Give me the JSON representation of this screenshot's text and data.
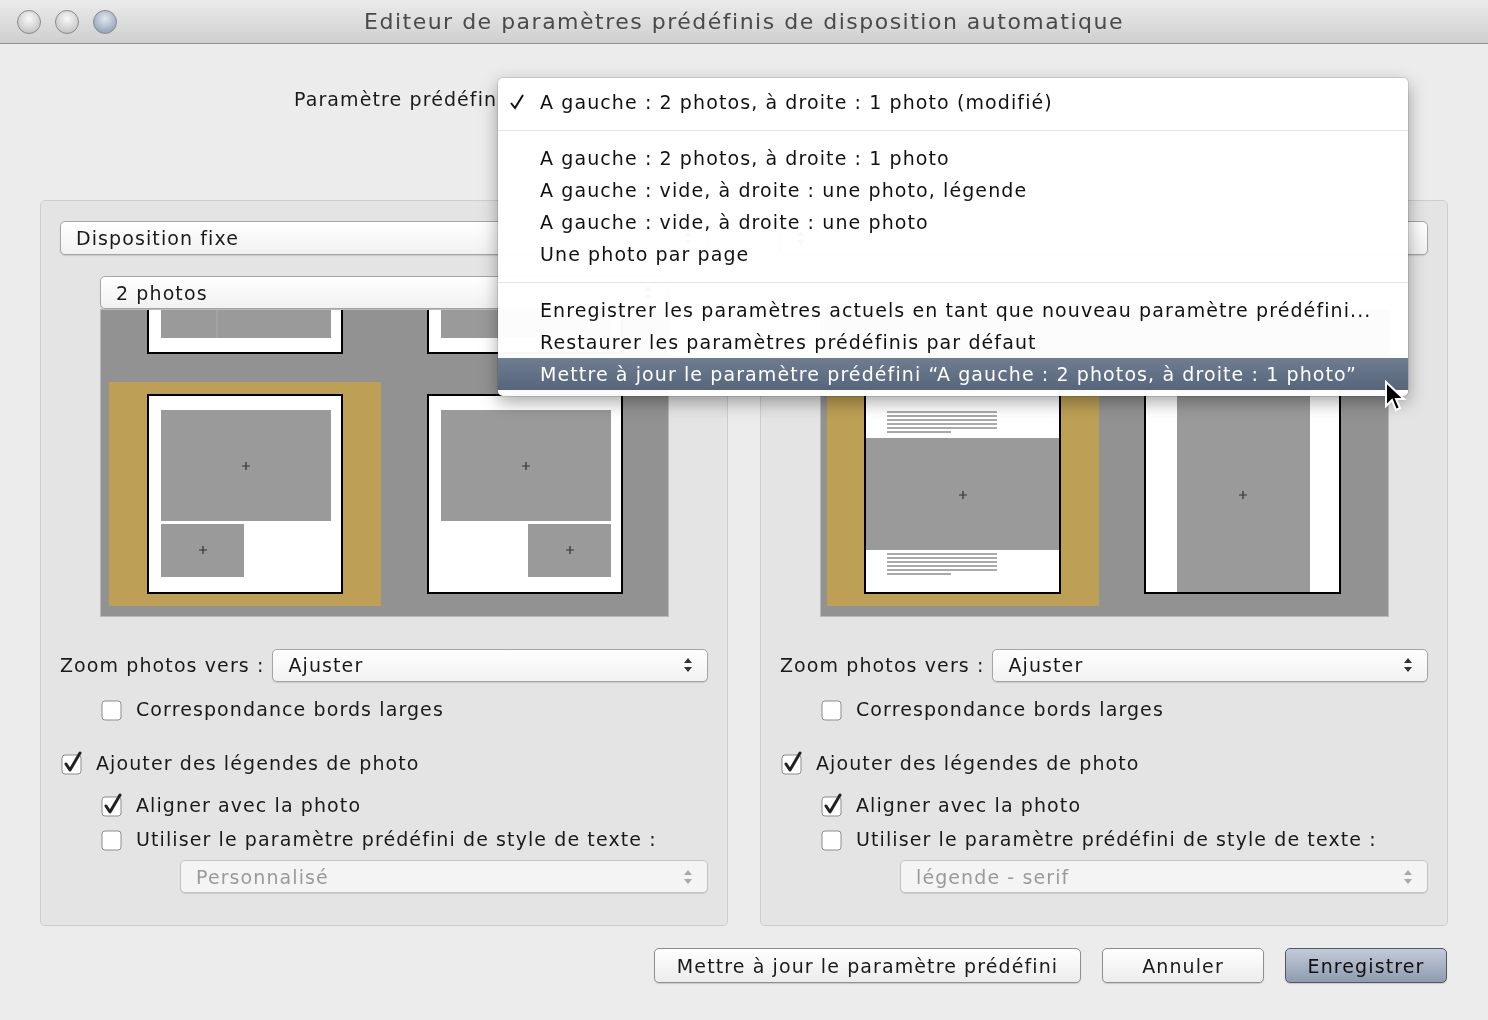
{
  "window": {
    "title": "Editeur de paramètres prédéfinis de disposition automatique"
  },
  "preset": {
    "label": "Paramètre prédéfin"
  },
  "menu": {
    "items": [
      {
        "kind": "item",
        "label": "A gauche : 2 photos, à droite : 1 photo (modifié)",
        "checked": true,
        "highlighted": false
      },
      {
        "kind": "separator"
      },
      {
        "kind": "item",
        "label": "A gauche : 2 photos, à droite : 1 photo",
        "checked": false,
        "highlighted": false
      },
      {
        "kind": "item",
        "label": "A gauche : vide, à droite : une photo, légende",
        "checked": false,
        "highlighted": false
      },
      {
        "kind": "item",
        "label": "A gauche : vide, à droite : une photo",
        "checked": false,
        "highlighted": false
      },
      {
        "kind": "item",
        "label": "Une photo par page",
        "checked": false,
        "highlighted": false
      },
      {
        "kind": "separator"
      },
      {
        "kind": "item",
        "label": "Enregistrer les paramètres actuels en tant que nouveau paramètre prédéfini...",
        "checked": false,
        "highlighted": false
      },
      {
        "kind": "item",
        "label": "Restaurer les paramètres prédéfinis par défaut",
        "checked": false,
        "highlighted": false
      },
      {
        "kind": "item",
        "label": "Mettre à jour le paramètre prédéfini “A gauche : 2 photos, à droite : 1 photo”",
        "checked": false,
        "highlighted": true
      }
    ]
  },
  "panels": [
    {
      "layout_select": {
        "value": "Disposition fixe"
      },
      "count_select": {
        "value": "2 photos"
      },
      "preview": {
        "kind": "two_photos"
      },
      "zoom": {
        "label": "Zoom photos vers :",
        "value": "Ajuster"
      },
      "wide_borders": {
        "label": "Correspondance bords larges",
        "checked": false
      },
      "captions": {
        "label": "Ajouter des légendes de photo",
        "checked": true,
        "children": [
          {
            "label": "Aligner avec la photo",
            "checked": true
          },
          {
            "label": "Utiliser le paramètre prédéfini de style de texte :",
            "checked": false
          }
        ]
      },
      "text_style": {
        "value": "Personnalisé",
        "disabled": true
      }
    },
    {
      "preview": {
        "kind": "one_photo_caption"
      },
      "zoom": {
        "label": "Zoom photos vers :",
        "value": "Ajuster"
      },
      "wide_borders": {
        "label": "Correspondance bords larges",
        "checked": false
      },
      "captions": {
        "label": "Ajouter des légendes de photo",
        "checked": true,
        "children": [
          {
            "label": "Aligner avec la photo",
            "checked": true
          },
          {
            "label": "Utiliser le paramètre prédéfini de style de texte :",
            "checked": false
          }
        ]
      },
      "text_style": {
        "value": "légende - serif",
        "disabled": true
      }
    }
  ],
  "buttons": [
    {
      "label": "Mettre à jour le paramètre prédéfini",
      "default": false
    },
    {
      "label": "Annuler",
      "default": false
    },
    {
      "label": "Enregistrer",
      "default": true
    }
  ]
}
